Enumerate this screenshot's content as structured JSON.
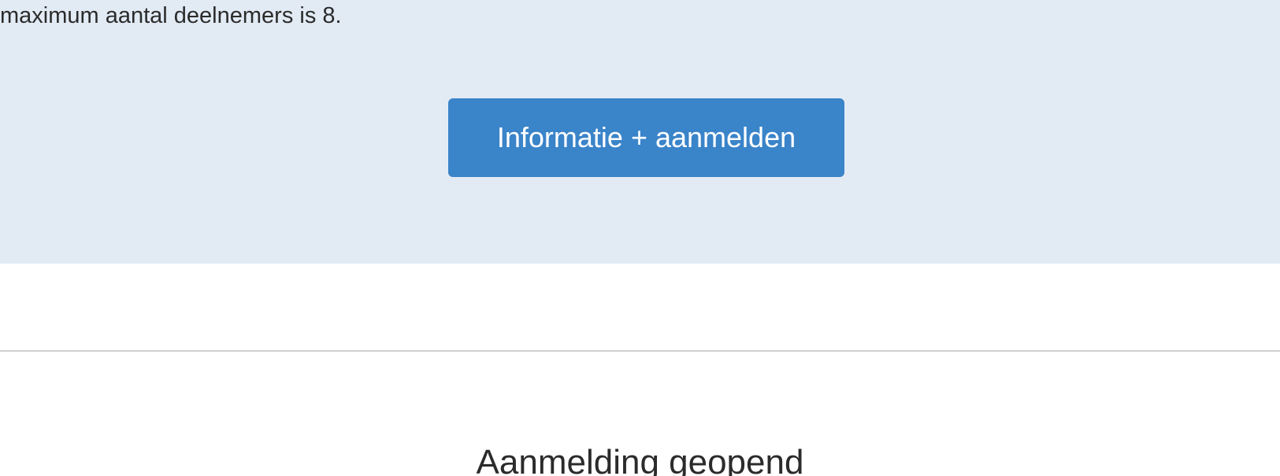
{
  "info_panel": {
    "text": "maximum aantal deelnemers is 8.",
    "button_label": "Informatie + aanmelden",
    "background_color": "#e2ebf4",
    "button_color": "#3a84c9"
  },
  "section": {
    "heading": "Aanmelding geopend"
  }
}
